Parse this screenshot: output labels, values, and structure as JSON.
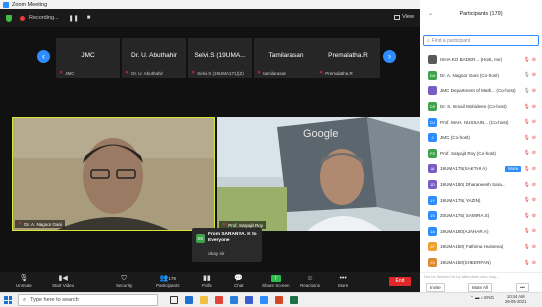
{
  "window": {
    "title": "Zoom Meeting"
  },
  "meeting_bar": {
    "recording_label": "Recording...",
    "view_label": "View"
  },
  "gallery": [
    {
      "name": "JMC",
      "sub": "JMC"
    },
    {
      "name": "Dr. U. Abuthahir",
      "sub": "Dr. U. Abuthahir"
    },
    {
      "name": "Selvi.S (19UMA...",
      "sub": "Selvi.S (19UMA171)(Z)"
    },
    {
      "name": "Tamilarasan",
      "sub": "tamilarasan"
    },
    {
      "name": "Premalatha.R",
      "sub": "Premalatha.R"
    }
  ],
  "videos": {
    "left_label": "Dr. A. Nagoor Gani",
    "right_label": "Prof. Satyajit Roy",
    "right_sign": "Google"
  },
  "chat_popup": {
    "avatar": "SK",
    "from": "From SARANYA. K to Everyone",
    "message": "okay sir"
  },
  "toolbar": {
    "unmute": "Unmute",
    "start_video": "Start Video",
    "security": "Security",
    "participants": "Participants",
    "participants_count": "179",
    "polls": "Polls",
    "chat": "Chat",
    "share_screen": "Share Screen",
    "reactions": "Reactions",
    "more": "More",
    "end": "End"
  },
  "panel": {
    "title": "Participants (179)",
    "search_placeholder": "Find a participant",
    "participants": [
      {
        "avatar": "",
        "name": "ISHA KO BADER... (Host, me)",
        "color": "#5a5a5a"
      },
      {
        "avatar": "DA",
        "name": "Dr. A. Nagoor Gani (Co-host)",
        "color": "#3fa34d"
      },
      {
        "avatar": "",
        "name": "JMC Department of Math... (Co-host)",
        "color": "#7a5cc7"
      },
      {
        "avatar": "DS",
        "name": "Dr. S. Ismail Mohideen (Co-host)",
        "color": "#3fa34d"
      },
      {
        "avatar": "DJ",
        "name": "Prof. MAH. HUSSAIN... (Co-host)",
        "color": "#2d8cff"
      },
      {
        "avatar": "J",
        "name": "JMC (Co-host)",
        "color": "#2d8cff"
      },
      {
        "avatar": "PS",
        "name": "Prof. Satyajit Roy (Co-host)",
        "color": "#3fa34d"
      },
      {
        "avatar": "IA",
        "name": "19UMA175(SAKTHI A)",
        "color": "#7a5cc7"
      },
      {
        "avatar": "1D",
        "name": "19UMA180( Dharaneesh Sara...",
        "color": "#7a5cc7"
      },
      {
        "avatar": "1Y",
        "name": "19UMA175( YAZIN)",
        "color": "#2d8cff"
      },
      {
        "avatar": "1S",
        "name": "20UMA175( SAMIRA.S)",
        "color": "#2d8cff"
      },
      {
        "avatar": "1A",
        "name": "19UMA180(AJAHAR.A)",
        "color": "#2d8cff"
      },
      {
        "avatar": "1F",
        "name": "19UMA180( Fathima Hussena)",
        "color": "#f0a030"
      },
      {
        "avatar": "1S",
        "name": "19UMA180(SHEERFAN)",
        "color": "#e08a30"
      }
    ],
    "more_button": "More",
    "footer_note": "Not be listened to by attendees who may...",
    "invite": "Invite",
    "mute_all": "Mute All"
  },
  "taskbar": {
    "search_placeholder": "Type here to search",
    "lang": "ENG",
    "time": "10:44 AM",
    "date": "26-05-2021"
  }
}
